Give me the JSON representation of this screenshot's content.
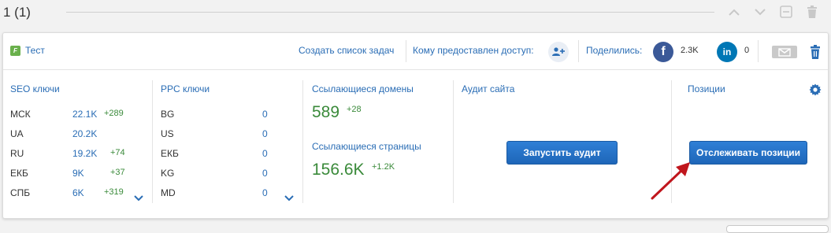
{
  "group": {
    "title": "1 (1)"
  },
  "project": {
    "name": "Тест",
    "icon": "project-favicon",
    "header": {
      "create_tasks": "Создать список задач",
      "access": "Кому предоставлен доступ:",
      "shared": "Поделились:",
      "facebook_count": "2.3K",
      "linkedin_count": "0",
      "facebook_letter": "f",
      "linkedin_letter": "in"
    }
  },
  "seo": {
    "title": "SEO ключи",
    "rows": [
      {
        "key": "МСК",
        "value": "22.1K",
        "delta": "+289"
      },
      {
        "key": "UA",
        "value": "20.2K",
        "delta": ""
      },
      {
        "key": "RU",
        "value": "19.2K",
        "delta": "+74"
      },
      {
        "key": "ЕКБ",
        "value": "9K",
        "delta": "+37"
      },
      {
        "key": "СПБ",
        "value": "6K",
        "delta": "+319"
      }
    ]
  },
  "ppc": {
    "title": "PPC ключи",
    "rows": [
      {
        "key": "BG",
        "value": "0"
      },
      {
        "key": "US",
        "value": "0"
      },
      {
        "key": "ЕКБ",
        "value": "0"
      },
      {
        "key": "KG",
        "value": "0"
      },
      {
        "key": "MD",
        "value": "0"
      }
    ]
  },
  "backlinks": {
    "domains_title": "Ссылающиеся домены",
    "domains_value": "589",
    "domains_delta": "+28",
    "pages_title": "Ссылающиеся страницы",
    "pages_value": "156.6K",
    "pages_delta": "+1.2K"
  },
  "audit": {
    "title": "Аудит сайта",
    "button": "Запустить аудит"
  },
  "positions": {
    "title": "Позиции",
    "button": "Отслеживать позиции"
  },
  "colors": {
    "link": "#2a6db5",
    "positive": "#3a8a3a",
    "button": "#1e66b8",
    "facebook": "#3b5998",
    "linkedin": "#0077b5",
    "arrow": "#c0161d"
  }
}
